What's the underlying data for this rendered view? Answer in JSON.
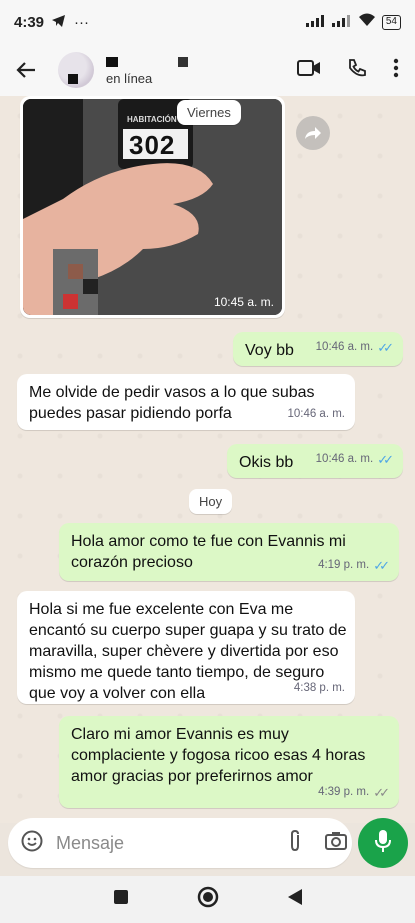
{
  "status_bar": {
    "time": "4:39",
    "extra": "···",
    "battery": "54"
  },
  "header": {
    "subtitle": "en línea"
  },
  "messages": {
    "photo_date_chip": "Viernes",
    "photo_label_top": "HABITACIÓN",
    "photo_room": "302",
    "photo_time": "10:45 a. m.",
    "m1": {
      "text": "Voy bb",
      "time": "10:46 a. m."
    },
    "m2": {
      "text": "Me olvide de pedir vasos a lo que subas puedes pasar pidiendo porfa",
      "time": "10:46 a. m."
    },
    "m3": {
      "text": "Okis bb",
      "time": "10:46 a. m."
    },
    "date_chip": "Hoy",
    "m4": {
      "text": "Hola amor como te fue con Evannis mi corazón precioso",
      "time": "4:19 p. m."
    },
    "m5": {
      "text": "Hola si me fue excelente con Eva me encantó su cuerpo super guapa y su trato de maravilla, super chèvere y divertida por eso mismo me quede tanto tiempo, de seguro que voy a volver con ella",
      "time": "4:38 p. m."
    },
    "m6": {
      "text": "Claro mi amor Evannis es muy complaciente y fogosa ricoo esas 4 horas amor gracias por preferirnos amor",
      "time": "4:39 p. m."
    }
  },
  "composer": {
    "placeholder": "Mensaje"
  },
  "colors": {
    "outgoing": "#dcf8c6",
    "incoming": "#ffffff",
    "mic": "#1aa34a",
    "read_ticks": "#4fa6e6"
  }
}
